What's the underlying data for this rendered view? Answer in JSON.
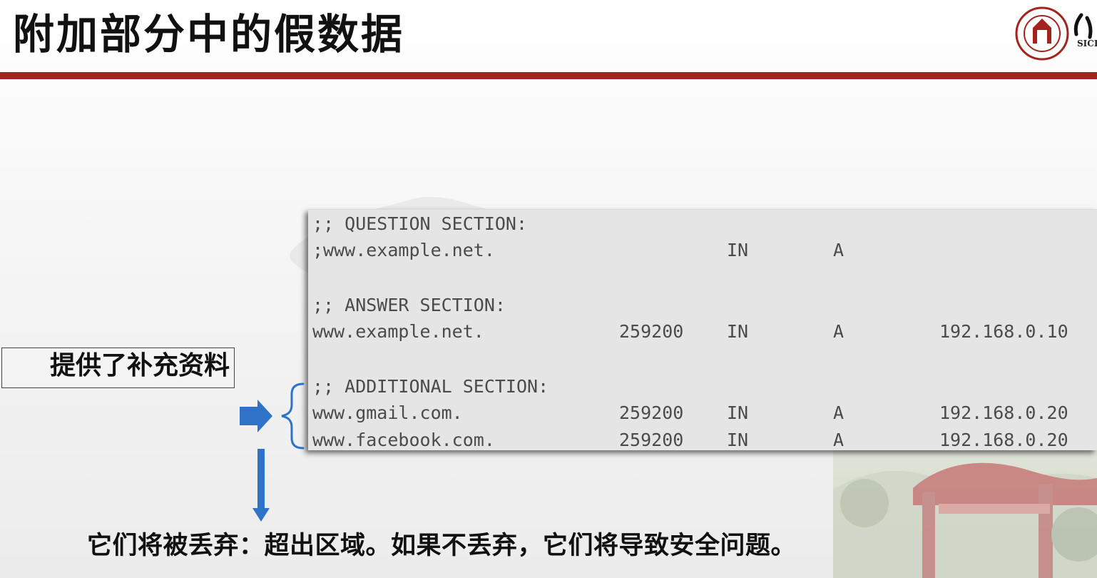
{
  "slide": {
    "title": "附加部分中的假数据",
    "logo_text": "SICI"
  },
  "dns": {
    "question_header": ";; QUESTION SECTION:",
    "question": {
      "name": ";www.example.net.",
      "class": "IN",
      "type": "A"
    },
    "answer_header": ";; ANSWER SECTION:",
    "answer": {
      "name": "www.example.net.",
      "ttl": "259200",
      "class": "IN",
      "type": "A",
      "address": "192.168.0.10"
    },
    "additional_header": ";; ADDITIONAL SECTION:",
    "additional": [
      {
        "name": "www.gmail.com.",
        "ttl": "259200",
        "class": "IN",
        "type": "A",
        "address": "192.168.0.20"
      },
      {
        "name": "www.facebook.com.",
        "ttl": "259200",
        "class": "IN",
        "type": "A",
        "address": "192.168.0.20"
      }
    ]
  },
  "callout": {
    "text": "提供了补充资料"
  },
  "bottom": {
    "note": "它们将被丢弃：超出区域。如果不丢弃，它们将导致安全问题。"
  },
  "colors": {
    "accent_red": "#a5231d",
    "arrow_blue": "#2f73c8",
    "panel_gray": "#e5e5e5"
  }
}
